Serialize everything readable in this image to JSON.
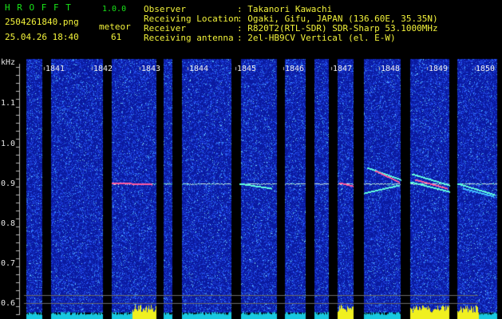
{
  "header": {
    "app_name": "H R O F F T",
    "version": "1.0.0",
    "filename": "2504261840.png",
    "meteor_label": "meteor",
    "meteor_count": "61",
    "datetime": "25.04.26 18:40",
    "fields": [
      {
        "label": "Observer",
        "value": ": Takanori Kawachi"
      },
      {
        "label": "Receiving Location",
        "value": ": Ogaki, Gifu, JAPAN (136.60E, 35.35N)"
      },
      {
        "label": "Receiver",
        "value": ": R820T2(RTL-SDR) SDR-Sharp 53.1000MHz"
      },
      {
        "label": "Receiving antenna",
        "value": ": 2el-HB9CV Vertical (el. E-W)"
      }
    ]
  },
  "axis": {
    "unit": "kHz",
    "ticks": [
      "1.1",
      "1.0",
      "0.9",
      "0.8",
      "0.7",
      "0.6"
    ]
  },
  "time_labels": [
    "1841",
    "1842",
    "1843",
    "1844",
    "1845",
    "1846",
    "1847",
    "1848",
    "1849",
    "1850"
  ],
  "colors": {
    "background": "#000000",
    "header_green": "#19e519",
    "header_yellow": "#f2f23a",
    "noise_blue": "#0a1aa0",
    "signal_line": "#c8f0e0",
    "meteor_echo": "#ff5aa0",
    "histogram_cyan": "#18c8e0",
    "histogram_yellow": "#f0f020"
  }
}
